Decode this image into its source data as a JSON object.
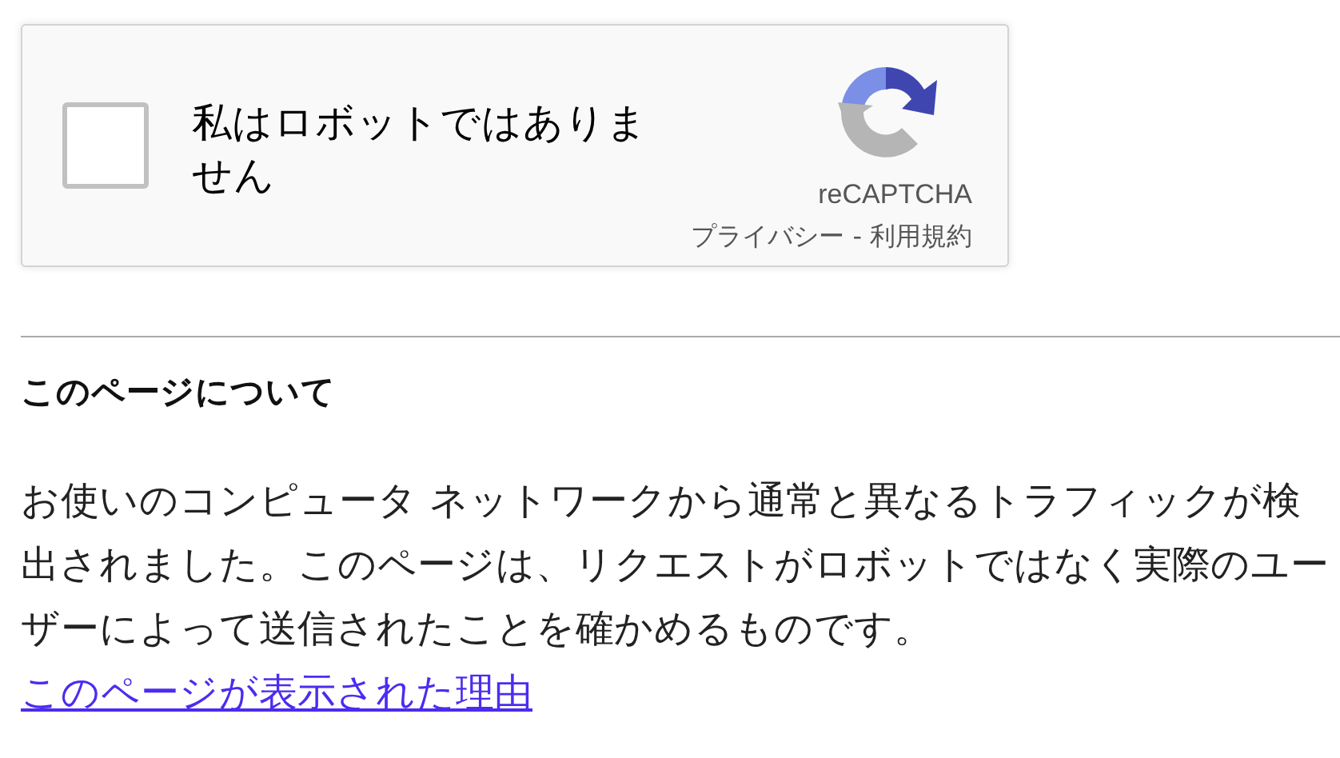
{
  "captcha": {
    "checked": false,
    "label": "私はロボットではありません",
    "brand": "reCAPTCHA",
    "links": [
      "プライバシー",
      "利用規約"
    ],
    "separator": "-"
  },
  "about": {
    "heading": "このページについて",
    "body": "お使いのコンピュータ ネットワークから通常と異なるトラフィックが検出されました。このページは、リクエストがロボットではなく実際のユーザーによって送信されたことを確かめるものです。",
    "link": "このページが表示された理由"
  }
}
